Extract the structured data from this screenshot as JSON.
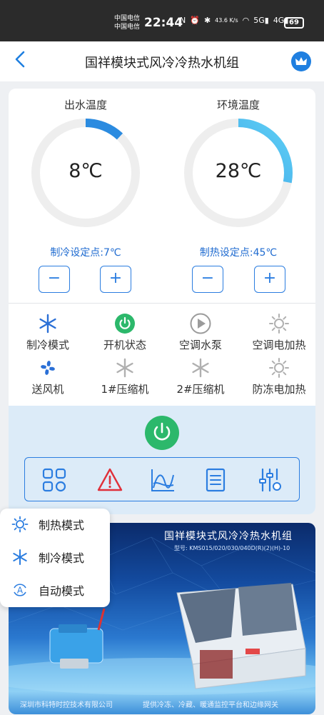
{
  "status_bar": {
    "carrier1": "中国电信",
    "carrier2": "中国电信",
    "time": "22:44",
    "speed": "43.6 K/s",
    "battery": "69"
  },
  "header": {
    "title": "国祥模块式风冷冷热水机组",
    "back_icon": "chevron-left-icon",
    "crown_icon": "crown-icon"
  },
  "gauges": {
    "outlet": {
      "label": "出水温度",
      "value": "8℃",
      "fill": 0.12
    },
    "ambient": {
      "label": "环境温度",
      "value": "28℃",
      "fill": 0.28
    }
  },
  "setpoints": {
    "cooling": {
      "label": "制冷设定点:7℃",
      "minus": "−",
      "plus": "+"
    },
    "heating": {
      "label": "制热设定点:45℃",
      "minus": "−",
      "plus": "+"
    }
  },
  "status_items": [
    {
      "label": "制冷模式",
      "icon": "snowflake-icon",
      "color": "#2a6fd6"
    },
    {
      "label": "开机状态",
      "icon": "power-on-icon",
      "color": "#2cb86b"
    },
    {
      "label": "空调水泵",
      "icon": "pump-play-icon",
      "color": "#9b9b9b"
    },
    {
      "label": "空调电加热",
      "icon": "sun-icon",
      "color": "#b0b0b0"
    },
    {
      "label": "送风机",
      "icon": "fan-icon",
      "color": "#2a6fd6"
    },
    {
      "label": "1#压缩机",
      "icon": "snowflake-icon",
      "color": "#b0b0b0"
    },
    {
      "label": "2#压缩机",
      "icon": "snowflake-icon",
      "color": "#b0b0b0"
    },
    {
      "label": "防冻电加热",
      "icon": "sun-icon",
      "color": "#b0b0b0"
    }
  ],
  "toolbar": [
    "grid-icon",
    "warning-icon",
    "chart-icon",
    "list-icon",
    "sliders-icon"
  ],
  "mode_menu": [
    {
      "label": "制热模式",
      "icon": "sun-icon"
    },
    {
      "label": "制冷模式",
      "icon": "snowflake-icon"
    },
    {
      "label": "自动模式",
      "icon": "auto-icon"
    }
  ],
  "banner": {
    "title": "国祥模块式风冷冷热水机组",
    "model": "型号: KMS015/020/030/040D(R)(2)(H)-10",
    "footer_left": "深圳市科特时控技术有限公司",
    "footer_right": "提供冷冻、冷藏、暖通监控平台和边缘网关"
  },
  "colors": {
    "accent": "#1f7fe0",
    "active_green": "#2cb86b",
    "panel_bg": "#dcebf8",
    "alert_red": "#e0303a"
  }
}
